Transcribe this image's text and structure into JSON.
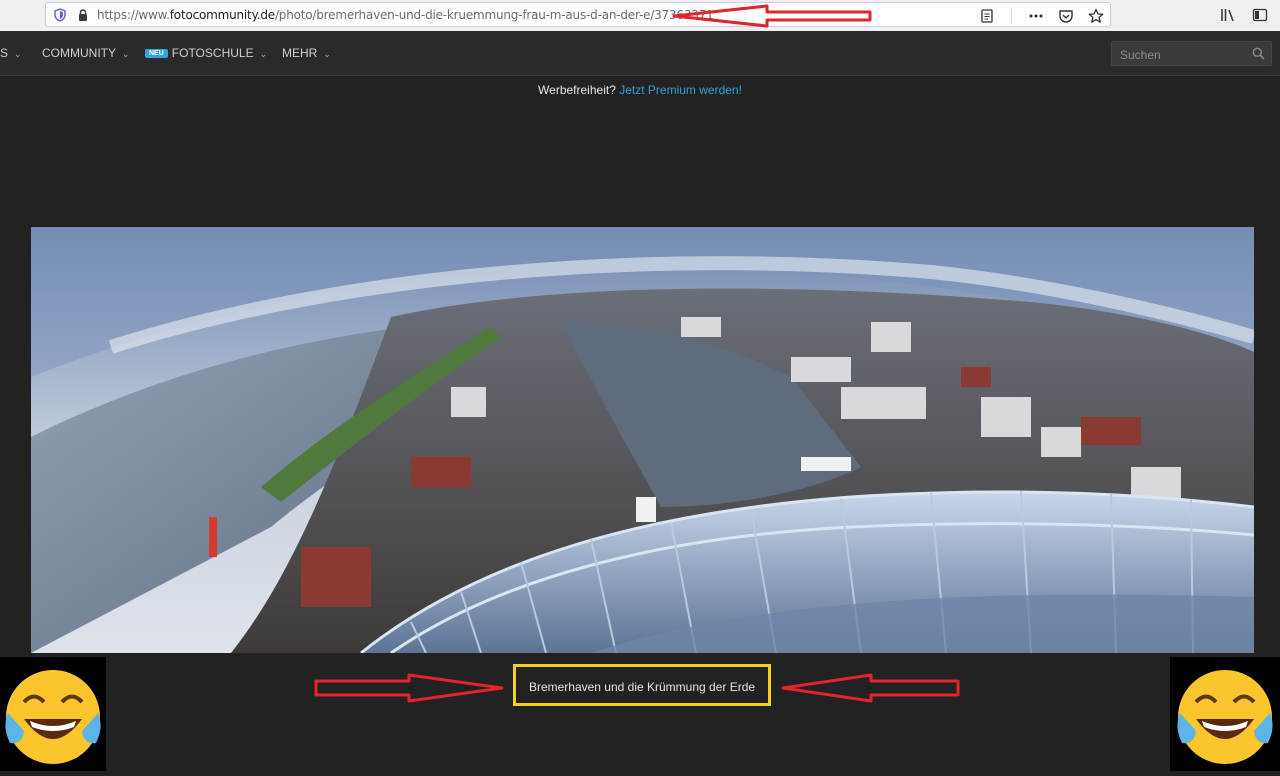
{
  "browser": {
    "url_prefix": "https://www.",
    "url_host": "fotocommunity.de",
    "url_path": "/photo/bremerhaven-und-die-kruemmung-frau-m-aus-d-an-der-e/37363371"
  },
  "nav": {
    "partial_item": "S",
    "items": [
      "COMMUNITY",
      "FOTOSCHULE",
      "MEHR"
    ],
    "new_badge": "NEU",
    "search_placeholder": "Suchen"
  },
  "premium": {
    "text": "Werbefreiheit?",
    "link": "Jetzt Premium werden!"
  },
  "photo": {
    "caption": "Bremerhaven und die Krümmung der Erde"
  },
  "colors": {
    "annotation_red": "#e0262b",
    "caption_frame": "#f5d21b",
    "link_blue": "#2ea3dd"
  },
  "icons": [
    "shield-icon",
    "lock-icon",
    "reader-view-icon",
    "more-icon",
    "pocket-icon",
    "bookmark-star-icon",
    "library-icon",
    "sidebar-icon",
    "chevron-down-icon",
    "search-icon",
    "laughing-emoji-icon"
  ]
}
